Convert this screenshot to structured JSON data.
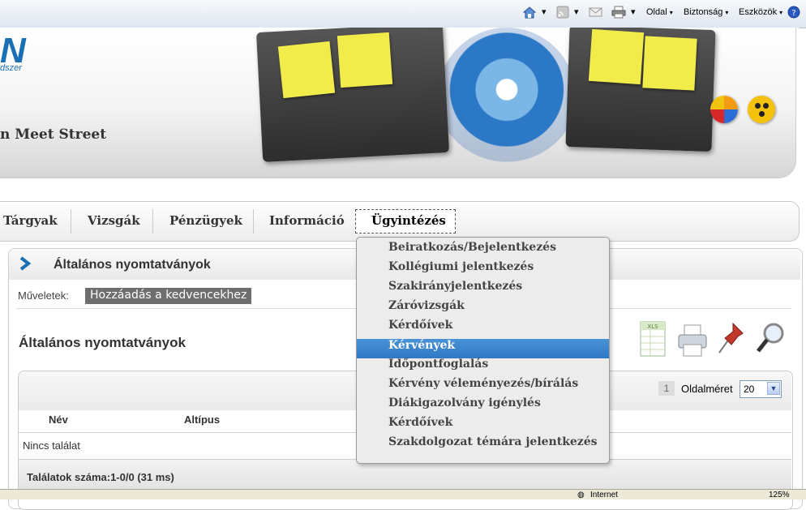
{
  "ie_toolbar": {
    "page_label": "Oldal",
    "safety_label": "Biztonság",
    "tools_label": "Eszközök",
    "help_icon": "help-icon",
    "home_icon": "home-icon",
    "feeds_icon": "rss-icon",
    "mail_icon": "mail-icon",
    "print_icon": "printer-icon"
  },
  "header": {
    "logo_text": "N",
    "logo_sub": "dszer",
    "street_text": "n Meet Street"
  },
  "nav": {
    "items": [
      "Tárgyak",
      "Vizsgák",
      "Pénzügyek",
      "Információ",
      "Ügyintézés"
    ],
    "active": "Ügyintézés"
  },
  "panel": {
    "title": "Általános nyomtatványok",
    "ops_label": "Műveletek:",
    "add_favorite": "Hozzáadás a kedvencekhez",
    "section_title": "Általános nyomtatványok",
    "tools": [
      "xls-export-icon",
      "printer-icon",
      "pin-icon",
      "magnifier-icon"
    ]
  },
  "grid": {
    "page_number": "1",
    "page_size_label": "Oldalméret",
    "page_size_value": "20",
    "columns": [
      "Név",
      "Altípus"
    ],
    "empty_text": "Nincs találat",
    "count_text": "Találatok száma:1-0/0 (31 ms)"
  },
  "dropdown": {
    "items": [
      "Beiratkozás/Bejelentkezés",
      "Kollégiumi jelentkezés",
      "Szakirányjelentkezés",
      "Záróvizsgák",
      "Kérdőívek",
      "Kérvények",
      "Időpontfoglalás",
      "Kérvény véleményezés/bírálás",
      "Diákigazolvány igénylés",
      "Kérdőívek",
      "Szakdolgozat témára jelentkezés"
    ],
    "selected_index": 5
  },
  "statusbar": {
    "zone": "Internet",
    "zoom": "125%"
  }
}
